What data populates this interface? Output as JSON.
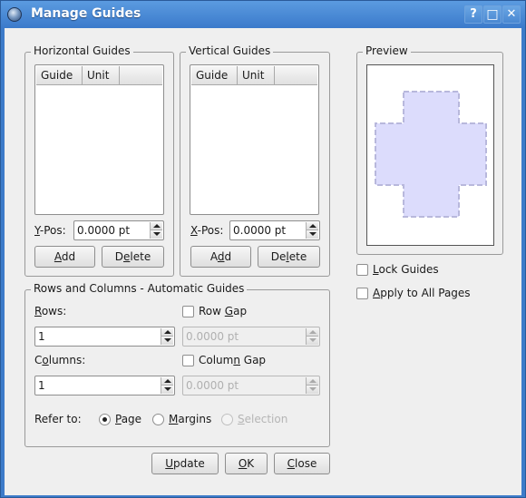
{
  "window": {
    "title": "Manage Guides",
    "controls": {
      "help": "?",
      "maximize": "□",
      "close": "✕"
    }
  },
  "horizontal_guides": {
    "title": "Horizontal Guides",
    "columns": [
      "Guide",
      "Unit",
      ""
    ],
    "rows": [],
    "pos_label_mnemonic": "Y",
    "pos_label_rest": "-Pos:",
    "pos_value": "0.0000 pt",
    "add_label_pre": "",
    "add_label_mnemonic": "A",
    "add_label_post": "dd",
    "delete_label_pre": "D",
    "delete_label_mnemonic": "e",
    "delete_label_post": "lete"
  },
  "vertical_guides": {
    "title": "Vertical Guides",
    "columns": [
      "Guide",
      "Unit",
      ""
    ],
    "rows": [],
    "pos_label_mnemonic": "X",
    "pos_label_rest": "-Pos:",
    "pos_value": "0.0000 pt",
    "add_label_pre": "A",
    "add_label_mnemonic": "d",
    "add_label_post": "d",
    "delete_label_pre": "De",
    "delete_label_mnemonic": "l",
    "delete_label_post": "ete"
  },
  "preview": {
    "title": "Preview",
    "shape_fill": "#dcdcfc",
    "shape_stroke": "#b8b8dc"
  },
  "options": {
    "lock_guides_mnemonic": "L",
    "lock_guides_rest": "ock Guides",
    "lock_guides_checked": false,
    "apply_all_mnemonic": "A",
    "apply_all_rest": "pply to All Pages",
    "apply_all_checked": false
  },
  "automatic": {
    "title": "Rows and Columns - Automatic Guides",
    "rows_label_mnemonic": "R",
    "rows_label_rest": "ows:",
    "rows_value": "1",
    "row_gap_pre": "Row ",
    "row_gap_mnemonic": "G",
    "row_gap_post": "ap",
    "row_gap_checked": false,
    "row_gap_value": "0.0000 pt",
    "columns_label_pre": "C",
    "columns_label_mnemonic": "o",
    "columns_label_post": "lumns:",
    "columns_value": "1",
    "column_gap_pre": "Colum",
    "column_gap_mnemonic": "n",
    "column_gap_post": " Gap",
    "column_gap_checked": false,
    "column_gap_value": "0.0000 pt",
    "refer_to_label": "Refer to:",
    "refer_options": [
      {
        "mnemonic": "P",
        "rest": "age",
        "selected": true,
        "enabled": true
      },
      {
        "mnemonic": "M",
        "rest": "argins",
        "selected": false,
        "enabled": true
      },
      {
        "mnemonic": "S",
        "rest": "election",
        "selected": false,
        "enabled": false
      }
    ]
  },
  "buttons": {
    "update_mnemonic": "U",
    "update_rest": "pdate",
    "ok_mnemonic": "O",
    "ok_rest": "K",
    "close_mnemonic": "C",
    "close_rest": "lose"
  }
}
